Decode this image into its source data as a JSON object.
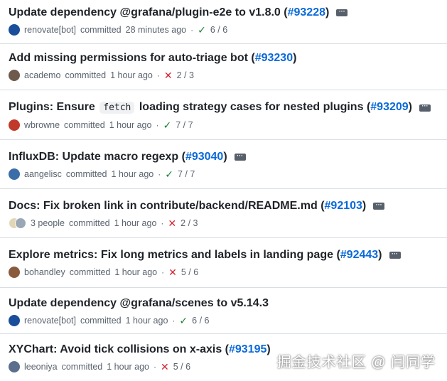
{
  "commits": [
    {
      "title": "Update dependency @grafana/plugin-e2e to v1.8.0",
      "title_code": "",
      "title_after": "",
      "pr": "#93228",
      "author": "renovate[bot]",
      "verb": "committed",
      "time": "28 minutes ago",
      "status": "check",
      "checks": "6 / 6",
      "avatar_color": "#1a4e9a",
      "has_menu": true
    },
    {
      "title": "Add missing permissions for auto-triage bot",
      "title_code": "",
      "title_after": "",
      "pr": "#93230",
      "author": "academo",
      "verb": "committed",
      "time": "1 hour ago",
      "status": "fail",
      "checks": "2 / 3",
      "avatar_color": "#6e5a4c",
      "has_menu": false
    },
    {
      "title": "Plugins: Ensure",
      "title_code": "fetch",
      "title_after": "loading strategy cases for nested plugins",
      "pr": "#93209",
      "author": "wbrowne",
      "verb": "committed",
      "time": "1 hour ago",
      "status": "check",
      "checks": "7 / 7",
      "avatar_color": "#c0392b",
      "has_menu": true
    },
    {
      "title": "InfluxDB: Update macro regexp",
      "title_code": "",
      "title_after": "",
      "pr": "#93040",
      "author": "aangelisc",
      "verb": "committed",
      "time": "1 hour ago",
      "status": "check",
      "checks": "7 / 7",
      "avatar_color": "#3b6ea8",
      "has_menu": true
    },
    {
      "title": "Docs: Fix broken link in contribute/backend/README.md",
      "title_code": "",
      "title_after": "",
      "pr": "#92103",
      "author": "3 people",
      "verb": "committed",
      "time": "1 hour ago",
      "status": "fail",
      "checks": "2 / 3",
      "avatar_color": "#d8c9a8",
      "has_menu": true,
      "multi_avatar": true
    },
    {
      "title": "Explore metrics: Fix long metrics and labels in landing page",
      "title_code": "",
      "title_after": "",
      "pr": "#92443",
      "author": "bohandley",
      "verb": "committed",
      "time": "1 hour ago",
      "status": "fail",
      "checks": "5 / 6",
      "avatar_color": "#8a5a3c",
      "has_menu": true
    },
    {
      "title": "Update dependency @grafana/scenes to v5.14.3",
      "title_code": "",
      "title_after": "",
      "pr": "",
      "author": "renovate[bot]",
      "verb": "committed",
      "time": "1 hour ago",
      "status": "check",
      "checks": "6 / 6",
      "avatar_color": "#1a4e9a",
      "has_menu": false
    },
    {
      "title": "XYChart: Avoid tick collisions on x-axis",
      "title_code": "",
      "title_after": "",
      "pr": "#93195",
      "author": "leeoniya",
      "verb": "committed",
      "time": "1 hour ago",
      "status": "fail",
      "checks": "5 / 6",
      "avatar_color": "#5b6f8c",
      "has_menu": false
    }
  ],
  "watermark": "掘金技术社区 @ 闫同学",
  "colors": {
    "link": "#0969da",
    "success": "#1a7f37",
    "danger": "#d1242f",
    "muted": "#59636e"
  }
}
